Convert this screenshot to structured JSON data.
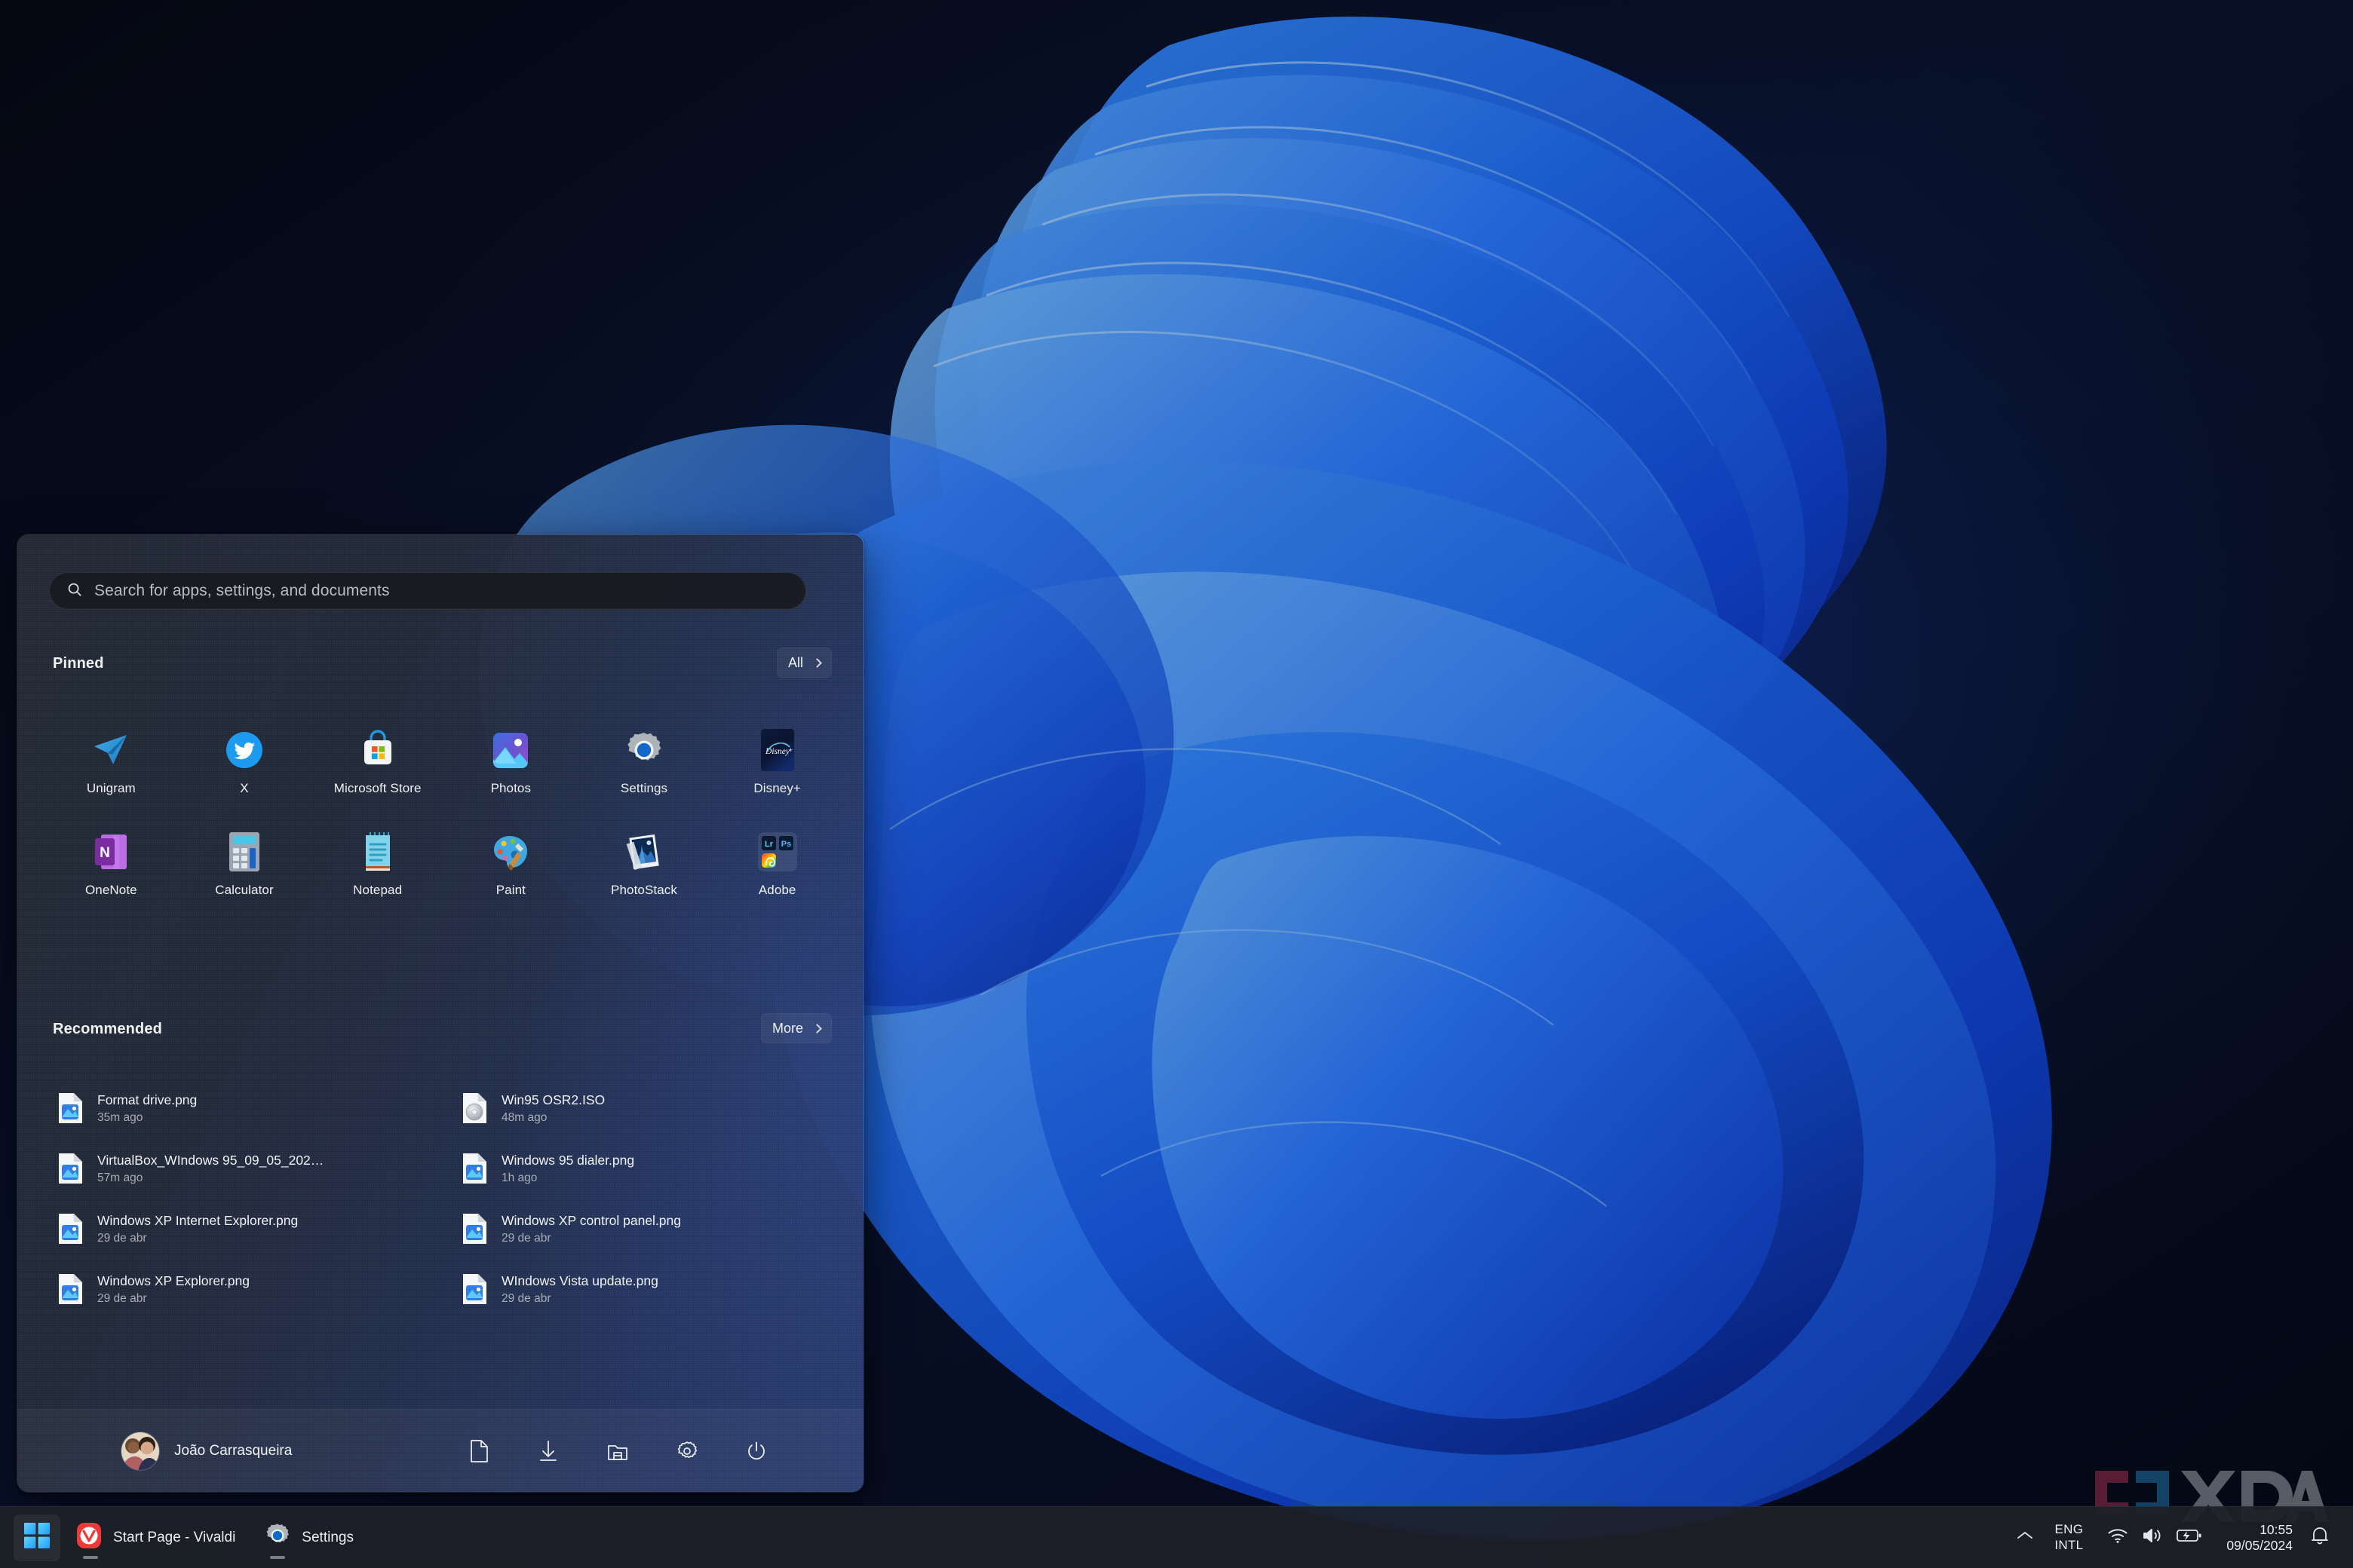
{
  "desktop": {
    "wallpaper_name": "windows-11-bloom-blue-abstract",
    "background_color": "#060a14",
    "accent_blue": "#1f6fe8",
    "ribbon_light": "#4a9bff",
    "ribbon_dark": "#0b3fbf"
  },
  "start_menu": {
    "search": {
      "placeholder": "Search for apps, settings, and documents",
      "value": "",
      "icon": "search-icon"
    },
    "pinned": {
      "title": "Pinned",
      "all_label": "All",
      "all_icon": "chevron-right-icon",
      "apps": [
        {
          "label": "Unigram",
          "icon": "unigram-icon"
        },
        {
          "label": "X",
          "icon": "x-twitter-icon"
        },
        {
          "label": "Microsoft Store",
          "icon": "microsoft-store-icon"
        },
        {
          "label": "Photos",
          "icon": "photos-icon"
        },
        {
          "label": "Settings",
          "icon": "settings-gear-icon"
        },
        {
          "label": "Disney+",
          "icon": "disney-plus-icon"
        },
        {
          "label": "OneNote",
          "icon": "onenote-icon"
        },
        {
          "label": "Calculator",
          "icon": "calculator-icon"
        },
        {
          "label": "Notepad",
          "icon": "notepad-icon"
        },
        {
          "label": "Paint",
          "icon": "paint-icon"
        },
        {
          "label": "PhotoStack",
          "icon": "photostack-icon"
        },
        {
          "label": "Adobe",
          "icon": "adobe-folder-icon"
        }
      ]
    },
    "recommended": {
      "title": "Recommended",
      "more_label": "More",
      "more_icon": "chevron-right-icon",
      "items": [
        {
          "name": "Format drive.png",
          "time": "35m ago",
          "icon": "png-file-icon"
        },
        {
          "name": "Win95 OSR2.ISO",
          "time": "48m ago",
          "icon": "iso-file-icon"
        },
        {
          "name": "VirtualBox_WIndows 95_09_05_202…",
          "time": "57m ago",
          "icon": "png-file-icon"
        },
        {
          "name": "Windows 95 dialer.png",
          "time": "1h ago",
          "icon": "png-file-icon"
        },
        {
          "name": "Windows XP Internet Explorer.png",
          "time": "29 de abr",
          "icon": "png-file-icon"
        },
        {
          "name": "Windows XP control panel.png",
          "time": "29 de abr",
          "icon": "png-file-icon"
        },
        {
          "name": "Windows XP Explorer.png",
          "time": "29 de abr",
          "icon": "png-file-icon"
        },
        {
          "name": "WIndows Vista update.png",
          "time": "29 de abr",
          "icon": "png-file-icon"
        }
      ]
    },
    "user_bar": {
      "user_name": "João Carrasqueira",
      "avatar_icon": "user-avatar-photo",
      "buttons": [
        {
          "name": "documents-button",
          "icon": "document-icon"
        },
        {
          "name": "downloads-button",
          "icon": "download-arrow-icon"
        },
        {
          "name": "pictures-button",
          "icon": "pictures-folder-icon"
        },
        {
          "name": "settings-button",
          "icon": "gear-icon"
        },
        {
          "name": "power-button",
          "icon": "power-icon"
        }
      ]
    }
  },
  "taskbar": {
    "start_button": {
      "icon": "windows-logo-icon",
      "active": true
    },
    "apps": [
      {
        "label": "Start Page - Vivaldi",
        "icon": "vivaldi-icon",
        "running": true
      },
      {
        "label": "Settings",
        "icon": "settings-gear-icon",
        "running": true
      }
    ],
    "tray": {
      "overflow_icon": "chevron-up-icon",
      "language_line1": "ENG",
      "language_line2": "INTL",
      "icons": [
        "wifi-icon",
        "volume-icon",
        "battery-charging-icon"
      ],
      "time": "10:55",
      "date": "09/05/2024",
      "notification_icon": "bell-icon"
    }
  },
  "watermark": {
    "text": "XDA",
    "bracket_left_color": "#9e2f4d",
    "bracket_right_color": "#1d72a8",
    "letters_color": "#9ba0a8"
  }
}
